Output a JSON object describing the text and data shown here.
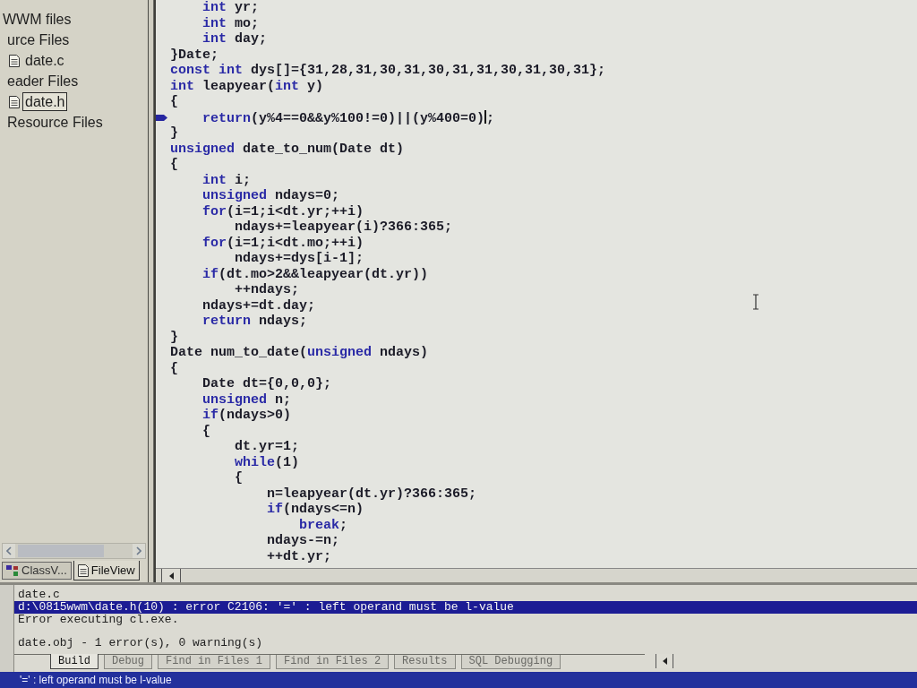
{
  "workspace": {
    "tree": [
      {
        "label": "WWM files",
        "file_icon": false,
        "selected": false,
        "children": [
          {
            "label": "urce Files",
            "file_icon": false,
            "selected": false,
            "children": [
              {
                "label": "date.c",
                "file_icon": true,
                "selected": false
              }
            ]
          },
          {
            "label": "eader Files",
            "file_icon": false,
            "selected": false,
            "children": [
              {
                "label": "date.h",
                "file_icon": true,
                "selected": true
              }
            ]
          },
          {
            "label": "Resource Files",
            "file_icon": false,
            "selected": false
          }
        ]
      }
    ],
    "tabs": [
      {
        "label": "ClassV...",
        "kind": "classes",
        "selected": false
      },
      {
        "label": "FileView",
        "kind": "files",
        "selected": true
      }
    ]
  },
  "editor": {
    "lines": [
      {
        "marker": false,
        "segments": [
          {
            "text": "    int",
            "kind": "keyword"
          },
          {
            "text": " yr;",
            "kind": "plain"
          }
        ]
      },
      {
        "marker": false,
        "segments": [
          {
            "text": "    int",
            "kind": "keyword"
          },
          {
            "text": " mo;",
            "kind": "plain"
          }
        ]
      },
      {
        "marker": false,
        "segments": [
          {
            "text": "    int",
            "kind": "keyword"
          },
          {
            "text": " day;",
            "kind": "plain"
          }
        ]
      },
      {
        "marker": false,
        "segments": [
          {
            "text": "}Date;",
            "kind": "plain"
          }
        ]
      },
      {
        "marker": false,
        "segments": [
          {
            "text": "const int",
            "kind": "keyword"
          },
          {
            "text": " dys[]={31,28,31,30,31,30,31,31,30,31,30,31};",
            "kind": "plain"
          }
        ]
      },
      {
        "marker": false,
        "segments": [
          {
            "text": "int",
            "kind": "keyword"
          },
          {
            "text": " leapyear(",
            "kind": "plain"
          },
          {
            "text": "int",
            "kind": "keyword"
          },
          {
            "text": " y)",
            "kind": "plain"
          }
        ]
      },
      {
        "marker": false,
        "segments": [
          {
            "text": "{",
            "kind": "plain"
          }
        ]
      },
      {
        "marker": true,
        "segments": [
          {
            "text": "    return",
            "kind": "keyword"
          },
          {
            "text": "(y%4==0&&y%100!=0)||(y%400=0)",
            "kind": "plain"
          },
          {
            "kind": "caret"
          },
          {
            "text": ";",
            "kind": "plain"
          }
        ]
      },
      {
        "marker": false,
        "segments": [
          {
            "text": "}",
            "kind": "plain"
          }
        ]
      },
      {
        "marker": false,
        "segments": [
          {
            "text": "unsigned",
            "kind": "keyword"
          },
          {
            "text": " date_to_num(Date dt)",
            "kind": "plain"
          }
        ]
      },
      {
        "marker": false,
        "segments": [
          {
            "text": "{",
            "kind": "plain"
          }
        ]
      },
      {
        "marker": false,
        "segments": [
          {
            "text": "    int",
            "kind": "keyword"
          },
          {
            "text": " i;",
            "kind": "plain"
          }
        ]
      },
      {
        "marker": false,
        "segments": [
          {
            "text": "    unsigned",
            "kind": "keyword"
          },
          {
            "text": " ndays=0;",
            "kind": "plain"
          }
        ]
      },
      {
        "marker": false,
        "segments": [
          {
            "text": "    for",
            "kind": "keyword"
          },
          {
            "text": "(i=1;i<dt.yr;++i)",
            "kind": "plain"
          }
        ]
      },
      {
        "marker": false,
        "segments": [
          {
            "text": "        ndays+=leapyear(i)?366:365;",
            "kind": "plain"
          }
        ]
      },
      {
        "marker": false,
        "segments": [
          {
            "text": "    for",
            "kind": "keyword"
          },
          {
            "text": "(i=1;i<dt.mo;++i)",
            "kind": "plain"
          }
        ]
      },
      {
        "marker": false,
        "segments": [
          {
            "text": "        ndays+=dys[i-1];",
            "kind": "plain"
          }
        ]
      },
      {
        "marker": false,
        "segments": [
          {
            "text": "    if",
            "kind": "keyword"
          },
          {
            "text": "(dt.mo>2&&leapyear(dt.yr))",
            "kind": "plain"
          }
        ]
      },
      {
        "marker": false,
        "segments": [
          {
            "text": "        ++ndays;",
            "kind": "plain"
          }
        ]
      },
      {
        "marker": false,
        "segments": [
          {
            "text": "    ndays+=dt.day;",
            "kind": "plain"
          }
        ]
      },
      {
        "marker": false,
        "segments": [
          {
            "text": "    return",
            "kind": "keyword"
          },
          {
            "text": " ndays;",
            "kind": "plain"
          }
        ]
      },
      {
        "marker": false,
        "segments": [
          {
            "text": "}",
            "kind": "plain"
          }
        ]
      },
      {
        "marker": false,
        "segments": [
          {
            "text": "Date num_to_date(",
            "kind": "plain"
          },
          {
            "text": "unsigned",
            "kind": "keyword"
          },
          {
            "text": " ndays)",
            "kind": "plain"
          }
        ]
      },
      {
        "marker": false,
        "segments": [
          {
            "text": "{",
            "kind": "plain"
          }
        ]
      },
      {
        "marker": false,
        "segments": [
          {
            "text": "    Date dt={0,0,0};",
            "kind": "plain"
          }
        ]
      },
      {
        "marker": false,
        "segments": [
          {
            "text": "    unsigned",
            "kind": "keyword"
          },
          {
            "text": " n;",
            "kind": "plain"
          }
        ]
      },
      {
        "marker": false,
        "segments": [
          {
            "text": "    if",
            "kind": "keyword"
          },
          {
            "text": "(ndays>0)",
            "kind": "plain"
          }
        ]
      },
      {
        "marker": false,
        "segments": [
          {
            "text": "    {",
            "kind": "plain"
          }
        ]
      },
      {
        "marker": false,
        "segments": [
          {
            "text": "        dt.yr=1;",
            "kind": "plain"
          }
        ]
      },
      {
        "marker": false,
        "segments": [
          {
            "text": "        while",
            "kind": "keyword"
          },
          {
            "text": "(1)",
            "kind": "plain"
          }
        ]
      },
      {
        "marker": false,
        "segments": [
          {
            "text": "        {",
            "kind": "plain"
          }
        ]
      },
      {
        "marker": false,
        "segments": [
          {
            "text": "            n=leapyear(dt.yr)?366:365;",
            "kind": "plain"
          }
        ]
      },
      {
        "marker": false,
        "segments": [
          {
            "text": "            if",
            "kind": "keyword"
          },
          {
            "text": "(ndays<=n)",
            "kind": "plain"
          }
        ]
      },
      {
        "marker": false,
        "segments": [
          {
            "text": "                break",
            "kind": "keyword"
          },
          {
            "text": ";",
            "kind": "plain"
          }
        ]
      },
      {
        "marker": false,
        "segments": [
          {
            "text": "            ndays-=n;",
            "kind": "plain"
          }
        ]
      },
      {
        "marker": false,
        "segments": [
          {
            "text": "            ++dt.yr;",
            "kind": "plain"
          }
        ]
      }
    ]
  },
  "output": {
    "blocks": [
      {
        "lines": [
          {
            "text": "date.c",
            "selected": false
          },
          {
            "text": "d:\\0815wwm\\date.h(10) : error C2106: '=' : left operand must be l-value",
            "selected": true
          },
          {
            "text": "Error executing cl.exe.",
            "selected": false
          }
        ]
      },
      {
        "lines": [
          {
            "text": "date.obj - 1 error(s), 0 warning(s)",
            "selected": false
          }
        ]
      }
    ],
    "tabs": [
      {
        "label": "Build",
        "selected": true
      },
      {
        "label": "Debug",
        "selected": false
      },
      {
        "label": "Find in Files 1",
        "selected": false
      },
      {
        "label": "Find in Files 2",
        "selected": false
      },
      {
        "label": "Results",
        "selected": false
      },
      {
        "label": "SQL Debugging",
        "selected": false
      }
    ]
  },
  "status_bar": {
    "text": "'=' : left operand must be l-value"
  }
}
